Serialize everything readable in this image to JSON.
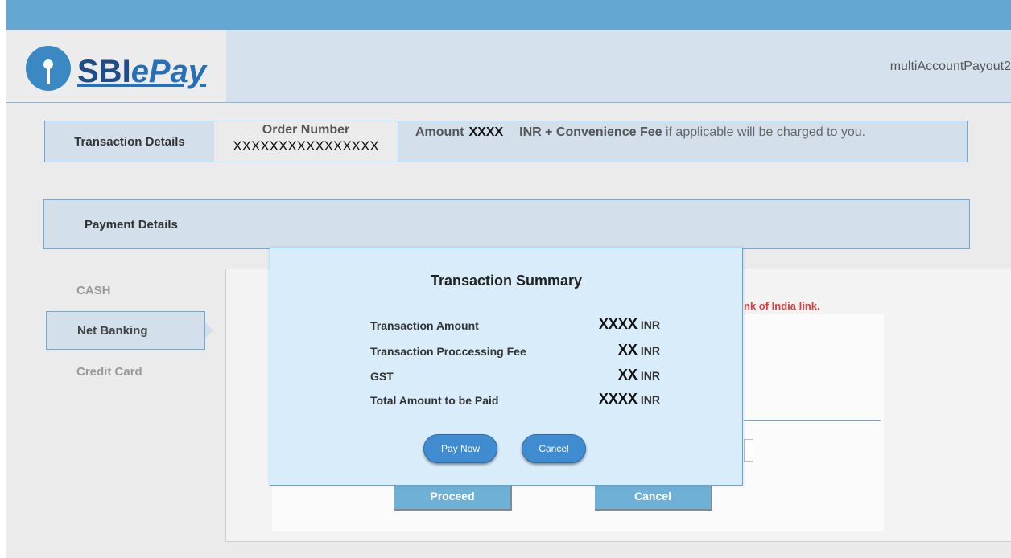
{
  "header": {
    "logo_text_sbi": "SBI",
    "logo_text_epay": "ePay",
    "account_name": "multiAccountPayout2"
  },
  "transaction": {
    "label": "Transaction Details",
    "order_number_label": "Order Number",
    "order_number_value": "XXXXXXXXXXXXXXXX",
    "amount_label": "Amount",
    "amount_value": "XXXX",
    "inr_convenience": "INR + Convenience Fee",
    "amount_suffix": "if applicable will be charged to you."
  },
  "payment": {
    "label": "Payment Details",
    "methods": [
      "CASH",
      "Net Banking",
      "Credit Card"
    ],
    "notice": "nk of India link.",
    "proceed_label": "Proceed",
    "cancel_label": "Cancel"
  },
  "modal": {
    "title": "Transaction Summary",
    "rows": [
      {
        "label": "Transaction Amount",
        "value": "XXXX",
        "currency": "INR"
      },
      {
        "label": "Transaction Proccessing Fee",
        "value": "XX",
        "currency": "INR"
      },
      {
        "label": "GST",
        "value": "XX",
        "currency": "INR"
      },
      {
        "label": "Total Amount to be Paid",
        "value": "XXXX",
        "currency": "INR"
      }
    ],
    "pay_now_label": "Pay Now",
    "cancel_label": "Cancel"
  },
  "colors": {
    "top_bar": "#63a7d2",
    "header_bg": "#d5e2ee",
    "panel_border": "#6aaad6",
    "modal_bg": "#d9ecfa",
    "button_blue": "#3f8dd0",
    "notice_red": "#e23b3b"
  },
  "icons": {
    "logo": "sbi-keyhole-logo-icon"
  }
}
